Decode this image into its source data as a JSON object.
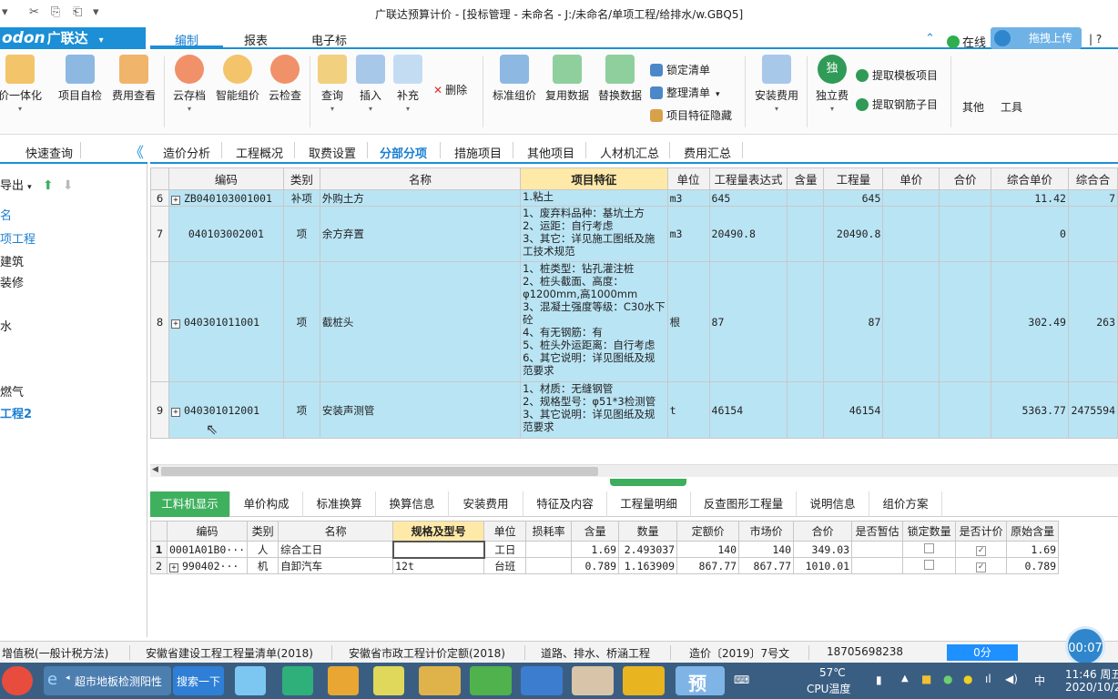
{
  "title_bar": {
    "quick_access": [
      "▾",
      "✂",
      "⎘",
      "⎗",
      "▾"
    ],
    "title": "广联达预算计价 - [投标管理 - 未命名 - J:/未命名/单项工程/给排水/w.GBQ5]"
  },
  "brand": {
    "latin": "odon",
    "cn": "广联达",
    "arrow": "▾"
  },
  "ribbon_tabs": [
    "编制",
    "报表",
    "电子标"
  ],
  "header_right": {
    "online": "在线",
    "upload": "拖拽上传",
    "chevron": "⌃"
  },
  "ribbon": {
    "buttons": [
      {
        "label": "价一体化",
        "icon": "price-integration-icon",
        "color": "#e8a33a"
      },
      {
        "label": "项目自检",
        "icon": "project-check-icon",
        "color": "#4c88c8"
      },
      {
        "label": "费用查看",
        "icon": "cost-view-icon",
        "color": "#d88a2a"
      },
      {
        "label": "云存档",
        "icon": "cloud-save-icon",
        "color": "#e26a3a"
      },
      {
        "label": "智能组价",
        "icon": "smart-pricing-icon",
        "color": "#e8a33a"
      },
      {
        "label": "云检查",
        "icon": "cloud-check-icon",
        "color": "#e26a3a"
      },
      {
        "label": "查询",
        "icon": "query-icon",
        "color": "#e2b23a"
      },
      {
        "label": "插入",
        "icon": "insert-icon",
        "color": "#4c88c8"
      },
      {
        "label": "补充",
        "icon": "supplement-icon",
        "color": "#6aa0d8"
      },
      {
        "label": "标准组价",
        "icon": "standard-pricing-icon",
        "color": "#4c88c8"
      },
      {
        "label": "复用数据",
        "icon": "reuse-data-icon",
        "color": "#3ea35a"
      },
      {
        "label": "替换数据",
        "icon": "replace-data-icon",
        "color": "#3ea35a"
      },
      {
        "label": "安装费用",
        "icon": "install-fee-icon",
        "color": "#4c88c8"
      },
      {
        "label": "独立费",
        "icon": "independent-fee-icon",
        "color": "#2f9b56"
      },
      {
        "label": "其他",
        "icon": "",
        "color": ""
      },
      {
        "label": "工具",
        "icon": "",
        "color": ""
      }
    ],
    "small": {
      "delete": "删除",
      "lock_list": "锁定清单",
      "organize_list": "整理清单",
      "hide_features": "项目特征隐藏",
      "extract_template": "提取模板项目",
      "extract_rebar": "提取钢筋子目"
    }
  },
  "left_panel": {
    "tab": "快速查询",
    "collapse": "《",
    "export": "导出",
    "tree": [
      "名",
      "项工程",
      "建筑",
      "装修",
      "水",
      "燃气",
      "工程2"
    ]
  },
  "main_tabs": [
    "造价分析",
    "工程概况",
    "取费设置",
    "分部分项",
    "措施项目",
    "其他项目",
    "人材机汇总",
    "费用汇总"
  ],
  "grid": {
    "headers": [
      "编码",
      "类别",
      "名称",
      "项目特征",
      "单位",
      "工程量表达式",
      "含量",
      "工程量",
      "单价",
      "合价",
      "综合单价",
      "综合合"
    ],
    "rows": [
      {
        "no": "6",
        "expand": "+",
        "code": "ZB040103001001",
        "type": "补项",
        "name": "外购土方",
        "features": [
          "1.粘土"
        ],
        "unit": "m3",
        "expr": "645",
        "content": "",
        "qty": "645",
        "price": "",
        "total": "",
        "unit_price": "11.42",
        "sum": "7"
      },
      {
        "no": "7",
        "expand": "",
        "code": "040103002001",
        "type": "项",
        "name": "余方弃置",
        "features": [
          "1、废弃料品种：基坑土方",
          "2、运距：自行考虑",
          "3、其它：详见施工图纸及施",
          "工技术规范"
        ],
        "unit": "m3",
        "expr": "20490.8",
        "content": "",
        "qty": "20490.8",
        "price": "",
        "total": "",
        "unit_price": "0",
        "sum": ""
      },
      {
        "no": "8",
        "expand": "+",
        "code": "040301011001",
        "type": "项",
        "name": "截桩头",
        "features": [
          "1、桩类型：钻孔灌注桩",
          "2、桩头截面、高度：",
          "φ1200mm,高1000mm",
          "3、混凝土强度等级：C30水下",
          "砼",
          "4、有无钢筋：有",
          "5、桩头外运距离：自行考虑",
          "6、其它说明：详见图纸及规",
          "范要求"
        ],
        "unit": "根",
        "expr": "87",
        "content": "",
        "qty": "87",
        "price": "",
        "total": "",
        "unit_price": "302.49",
        "sum": "263"
      },
      {
        "no": "9",
        "expand": "+",
        "code": "040301012001",
        "type": "项",
        "name": "安装声测管",
        "features": [
          "1、材质：无缝钢管",
          "2、规格型号：φ51*3检测管",
          "3、其它说明：详见图纸及规",
          "范要求"
        ],
        "unit": "t",
        "expr": "46154",
        "content": "",
        "qty": "46154",
        "price": "",
        "total": "",
        "unit_price": "5363.77",
        "sum": "2475594"
      }
    ]
  },
  "bottom_tabs": [
    "工料机显示",
    "单价构成",
    "标准换算",
    "换算信息",
    "安装费用",
    "特征及内容",
    "工程量明细",
    "反查图形工程量",
    "说明信息",
    "组价方案"
  ],
  "bottom_grid": {
    "headers": [
      "编码",
      "类别",
      "名称",
      "规格及型号",
      "单位",
      "损耗率",
      "含量",
      "数量",
      "定额价",
      "市场价",
      "合价",
      "是否暂估",
      "锁定数量",
      "是否计价",
      "原始含量"
    ],
    "rows": [
      {
        "no": "1",
        "expand": "",
        "code": "0001A01B0···",
        "type": "人",
        "name": "综合工日",
        "spec": "",
        "unit": "工日",
        "loss": "",
        "content": "1.69",
        "qty": "2.493037",
        "quota": "140",
        "market": "140",
        "total": "349.03",
        "est": "",
        "lock": "",
        "priced": "✓",
        "orig": "1.69"
      },
      {
        "no": "2",
        "expand": "+",
        "code": "990402···",
        "type": "机",
        "name": "自卸汽车",
        "spec": "12t",
        "unit": "台班",
        "loss": "",
        "content": "0.789",
        "qty": "1.163909",
        "quota": "867.77",
        "market": "867.77",
        "total": "1010.01",
        "est": "",
        "lock": "",
        "priced": "✓",
        "orig": "0.789"
      }
    ]
  },
  "status_bar": {
    "items": [
      "增值税(一般计税方法)",
      "安徽省建设工程工程量清单(2018)",
      "安徽省市政工程计价定额(2018)",
      "道路、排水、桥涵工程",
      "造价〔2019〕7号文",
      "18705698238"
    ],
    "progress": "0分",
    "timer": "00:07"
  },
  "taskbar": {
    "browser_item": "超市地板检测阳性",
    "search_button": "搜索一下",
    "app_label": "预",
    "temperature": "57℃",
    "cpu_label": "CPU温度",
    "time": "11:46 周五",
    "date": "2020/10/2"
  },
  "colors": {
    "accent": "#1c8fd6",
    "row_highlight": "#b9e4f4",
    "feature_header": "#ffe9a8",
    "active_bottom_tab": "#3fb05e",
    "taskbar": "#3a5e82"
  }
}
